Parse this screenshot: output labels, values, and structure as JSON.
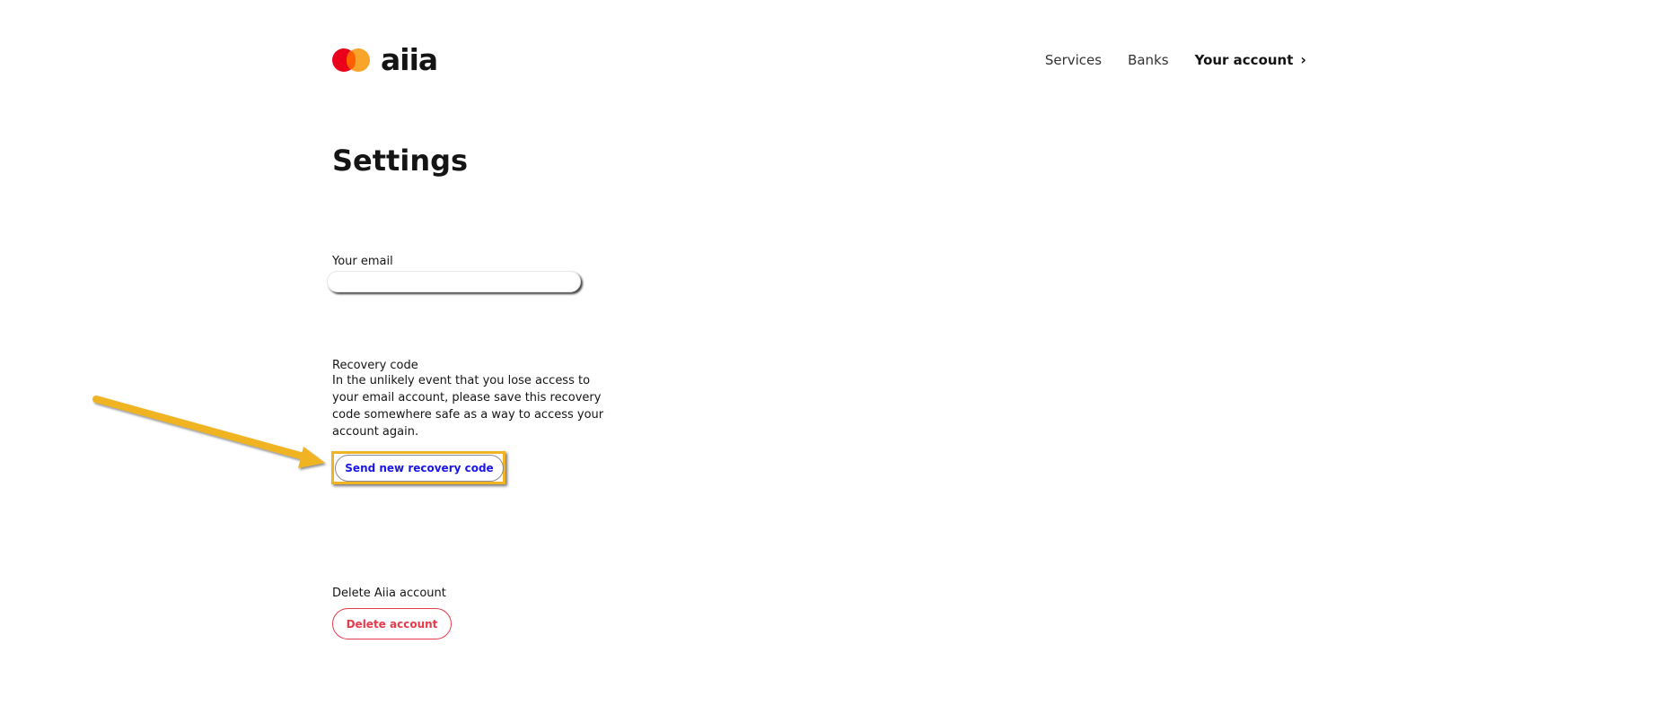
{
  "header": {
    "logo_text": "aiia",
    "nav": {
      "services": "Services",
      "banks": "Banks",
      "account": "Your account",
      "account_chevron": "›"
    }
  },
  "main": {
    "title": "Settings",
    "email": {
      "label": "Your email",
      "value": ""
    },
    "recovery": {
      "label": "Recovery code",
      "description": "In the unlikely event that you lose access to your email account, please save this recovery code somewhere safe as a way to access your account again.",
      "button_label": "Send new recovery code"
    },
    "delete": {
      "label": "Delete Aiia account",
      "button_label": "Delete account"
    }
  },
  "annotation": {
    "icon": "arrow-icon",
    "color": "#f0b323"
  },
  "colors": {
    "brand_red": "#eb001b",
    "brand_orange": "#f79e1b",
    "link_blue": "#1a16e8",
    "danger": "#e63b4b"
  }
}
